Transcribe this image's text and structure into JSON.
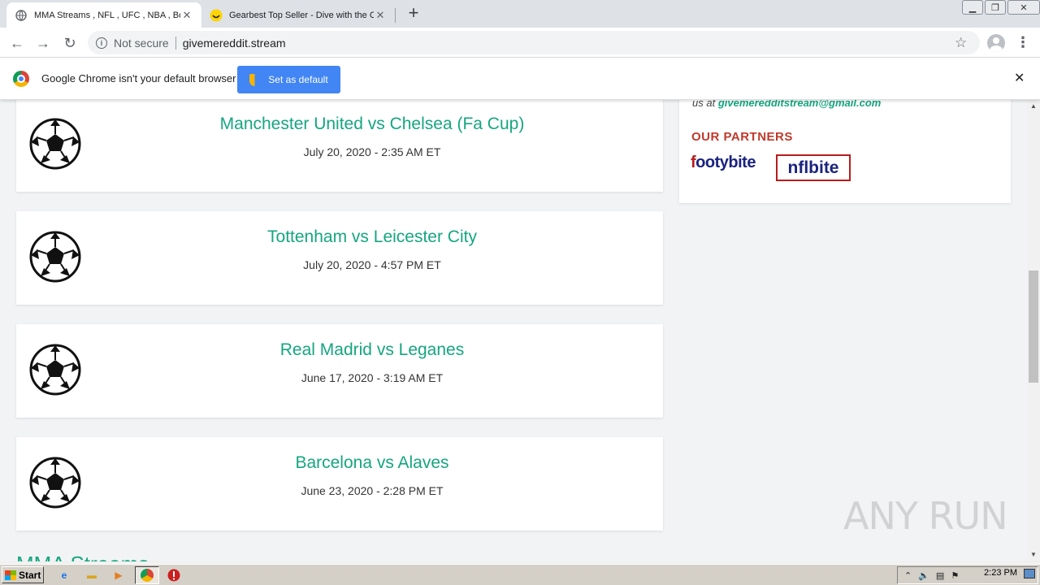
{
  "browser": {
    "tabs": [
      {
        "title": "MMA Streams , NFL , UFC , NBA , Bo",
        "icon": "globe-icon",
        "active": true
      },
      {
        "title": "Gearbest Top Seller - Dive with the C",
        "icon": "smiley-icon",
        "active": false
      }
    ],
    "address": {
      "security_label": "Not secure",
      "url": "givemereddit.stream"
    },
    "infobar": {
      "message": "Google Chrome isn't your default browser",
      "button_label": "Set as default"
    }
  },
  "page": {
    "sidebar": {
      "contact_prefix": "us at",
      "contact_email": "givemeredditstream@gmail.com",
      "partners_heading": "OUR PARTNERS",
      "partners": [
        {
          "name": "footybite",
          "prefix": "f",
          "rest": "ootybite"
        },
        {
          "name": "nflbite"
        }
      ]
    },
    "matches": [
      {
        "title": "Manchester United vs Chelsea (Fa Cup)",
        "time": "July 20, 2020 - 2:35 AM ET"
      },
      {
        "title": "Tottenham vs Leicester City",
        "time": "July 20, 2020 - 4:57 PM ET"
      },
      {
        "title": "Real Madrid vs Leganes",
        "time": "June 17, 2020 - 3:19 AM ET"
      },
      {
        "title": "Barcelona vs Alaves",
        "time": "June 23, 2020 - 2:28 PM ET"
      }
    ],
    "next_section": "MMA Streams"
  },
  "watermark": "ANY RUN",
  "taskbar": {
    "start_label": "Start",
    "clock": "2:23 PM"
  },
  "colors": {
    "accent_green": "#15a67f",
    "partners_red": "#c0392b",
    "infobar_button": "#4285f4"
  }
}
